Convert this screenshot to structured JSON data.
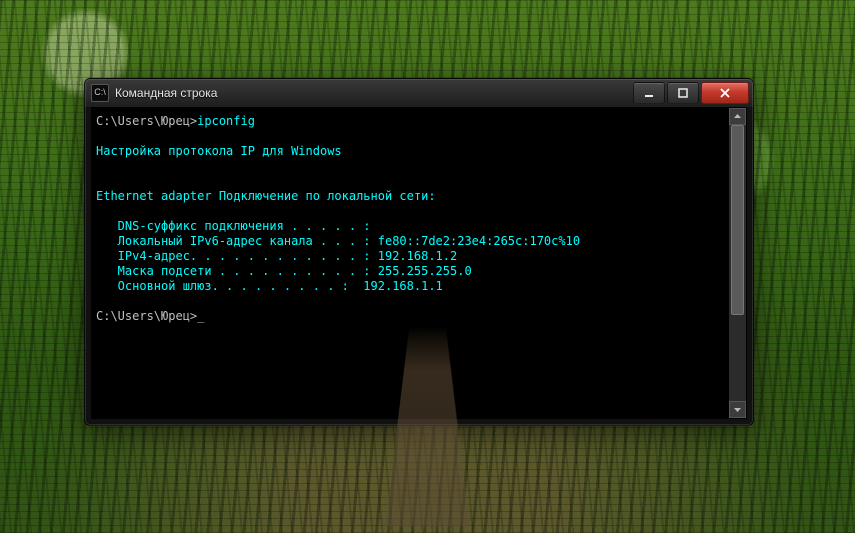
{
  "window": {
    "title": "Командная строка",
    "icon_label": "C:\\",
    "buttons": {
      "minimize": "minimize",
      "maximize": "maximize",
      "close": "close"
    }
  },
  "terminal": {
    "prompt1_path": "C:\\Users\\Юрец>",
    "prompt1_cmd": "ipconfig",
    "blank1": "",
    "heading": "Настройка протокола IP для Windows",
    "blank2": "",
    "blank3": "",
    "adapter": "Ethernet adapter Подключение по локальной сети:",
    "blank4": "",
    "line_dns": "   DNS-суффикс подключения . . . . . :",
    "line_ipv6": "   Локальный IPv6-адрес канала . . . : fe80::7de2:23e4:265c:170c%10",
    "line_ipv4": "   IPv4-адрес. . . . . . . . . . . . : 192.168.1.2",
    "line_mask": "   Маска подсети . . . . . . . . . . : 255.255.255.0",
    "line_gw": "   Основной шлюз. . . . . . . . . :  192.168.1.1",
    "blank5": "",
    "prompt2_path": "C:\\Users\\Юрец>",
    "cursor": "_"
  }
}
